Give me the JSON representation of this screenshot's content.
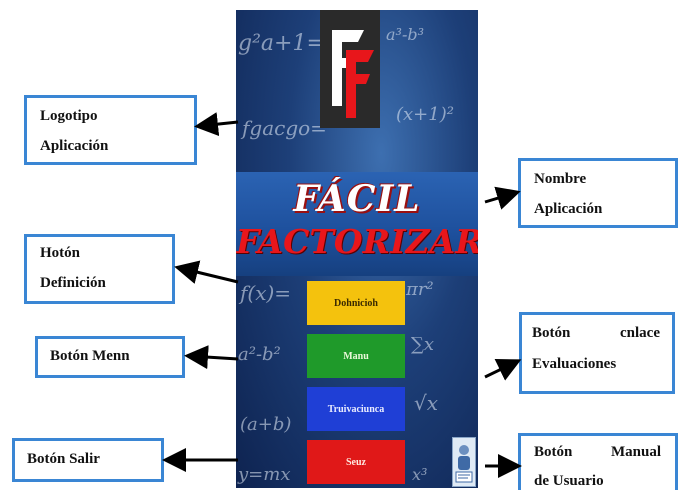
{
  "app": {
    "title_line1": "FÁCIL",
    "title_line2": "FACTORIZAR"
  },
  "buttons": {
    "definition": "Dohnicioh",
    "menu": "Manu",
    "evaluations": "Truivaciunca",
    "exit": "Seuz"
  },
  "callouts": {
    "logo": {
      "line1": "Logotipo",
      "line2": "Aplicación"
    },
    "name": {
      "line1": "Nombre",
      "line2": "Aplicación"
    },
    "definition": {
      "line1": "Hotón",
      "line2": "Definición"
    },
    "menu": {
      "line1": "Botón Menn"
    },
    "evaluations": {
      "line1a": "Botón",
      "line1b": "cnlace",
      "line2": "Evaluaciones"
    },
    "exit": {
      "line1": "Botón Salir"
    },
    "manual": {
      "line1a": "Botón",
      "line1b": "Manual",
      "line2": "de Usuario"
    }
  },
  "colors": {
    "callout_border": "#3a86d4",
    "btn_definition": "#f4c20d",
    "btn_menu": "#1f9a2a",
    "btn_evaluations": "#1f3fd6",
    "btn_exit": "#e01818",
    "title_red": "#e8161b"
  },
  "icons": {
    "logo": "ff-logo-icon",
    "manual": "user-manual-icon",
    "arrows": "arrow-right-icon"
  }
}
